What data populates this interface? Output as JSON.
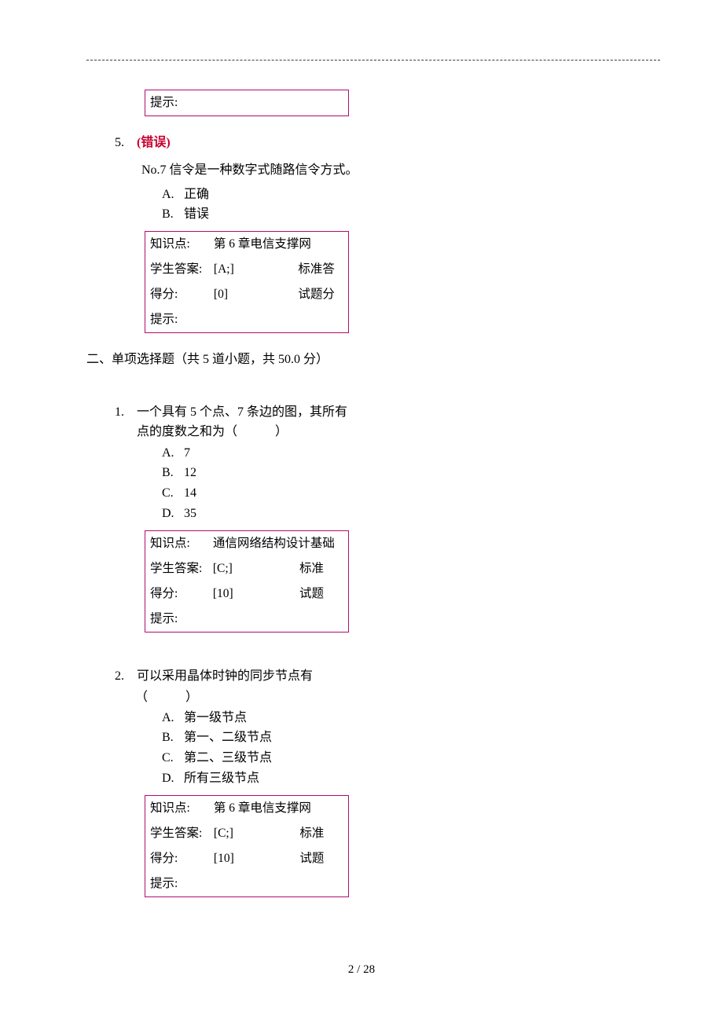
{
  "box0": {
    "hint_label": "提示:"
  },
  "q5": {
    "num": "5.",
    "status": "(错误)",
    "text": "No.7 信令是一种数字式随路信令方式。",
    "opts": {
      "a_letter": "A.",
      "a_text": "正确",
      "b_letter": "B.",
      "b_text": "错误"
    },
    "box": {
      "kp_label": "知识点:",
      "kp_val": "第 6 章电信支撑网",
      "sa_label": "学生答案:",
      "sa_val": "[A;]",
      "sa_right": "标准答",
      "sc_label": "得分:",
      "sc_val": "[0]",
      "sc_right": "试题分",
      "hint_label": "提示:"
    }
  },
  "section2": {
    "title": "二、单项选择题（共 5 道小题，共 50.0 分）"
  },
  "q1": {
    "num": "1.",
    "text": "一个具有 5 个点、7 条边的图，其所有点的度数之和为（　　　）",
    "opts": {
      "a_letter": "A.",
      "a_text": "7",
      "b_letter": "B.",
      "b_text": "12",
      "c_letter": "C.",
      "c_text": "14",
      "d_letter": "D.",
      "d_text": "35"
    },
    "box": {
      "kp_label": "知识点:",
      "kp_val": "通信网络结构设计基础",
      "sa_label": "学生答案:",
      "sa_val": "[C;]",
      "sa_right": "标准",
      "sc_label": "得分:",
      "sc_val": "[10]",
      "sc_right": "试题",
      "hint_label": "提示:"
    }
  },
  "q2": {
    "num": "2.",
    "text_line1": "可以采用晶体时钟的同步节点有",
    "text_line2": "（　　　）",
    "opts": {
      "a_letter": "A.",
      "a_text": "第一级节点",
      "b_letter": "B.",
      "b_text": "第一、二级节点",
      "c_letter": "C.",
      "c_text": "第二、三级节点",
      "d_letter": "D.",
      "d_text": "所有三级节点"
    },
    "box": {
      "kp_label": "知识点:",
      "kp_val": "第 6 章电信支撑网",
      "sa_label": "学生答案:",
      "sa_val": "[C;]",
      "sa_right": "标准",
      "sc_label": "得分:",
      "sc_val": "[10]",
      "sc_right": "试题",
      "hint_label": "提示:"
    }
  },
  "footer": {
    "page": "2 / 28"
  }
}
